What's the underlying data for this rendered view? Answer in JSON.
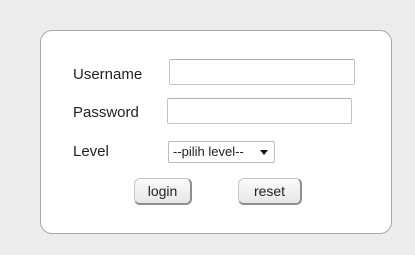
{
  "form": {
    "username_label": "Username",
    "username_value": "",
    "password_label": "Password",
    "password_value": "",
    "level_label": "Level",
    "level_selected": "--pilih level--",
    "login_label": "login",
    "reset_label": "reset"
  }
}
